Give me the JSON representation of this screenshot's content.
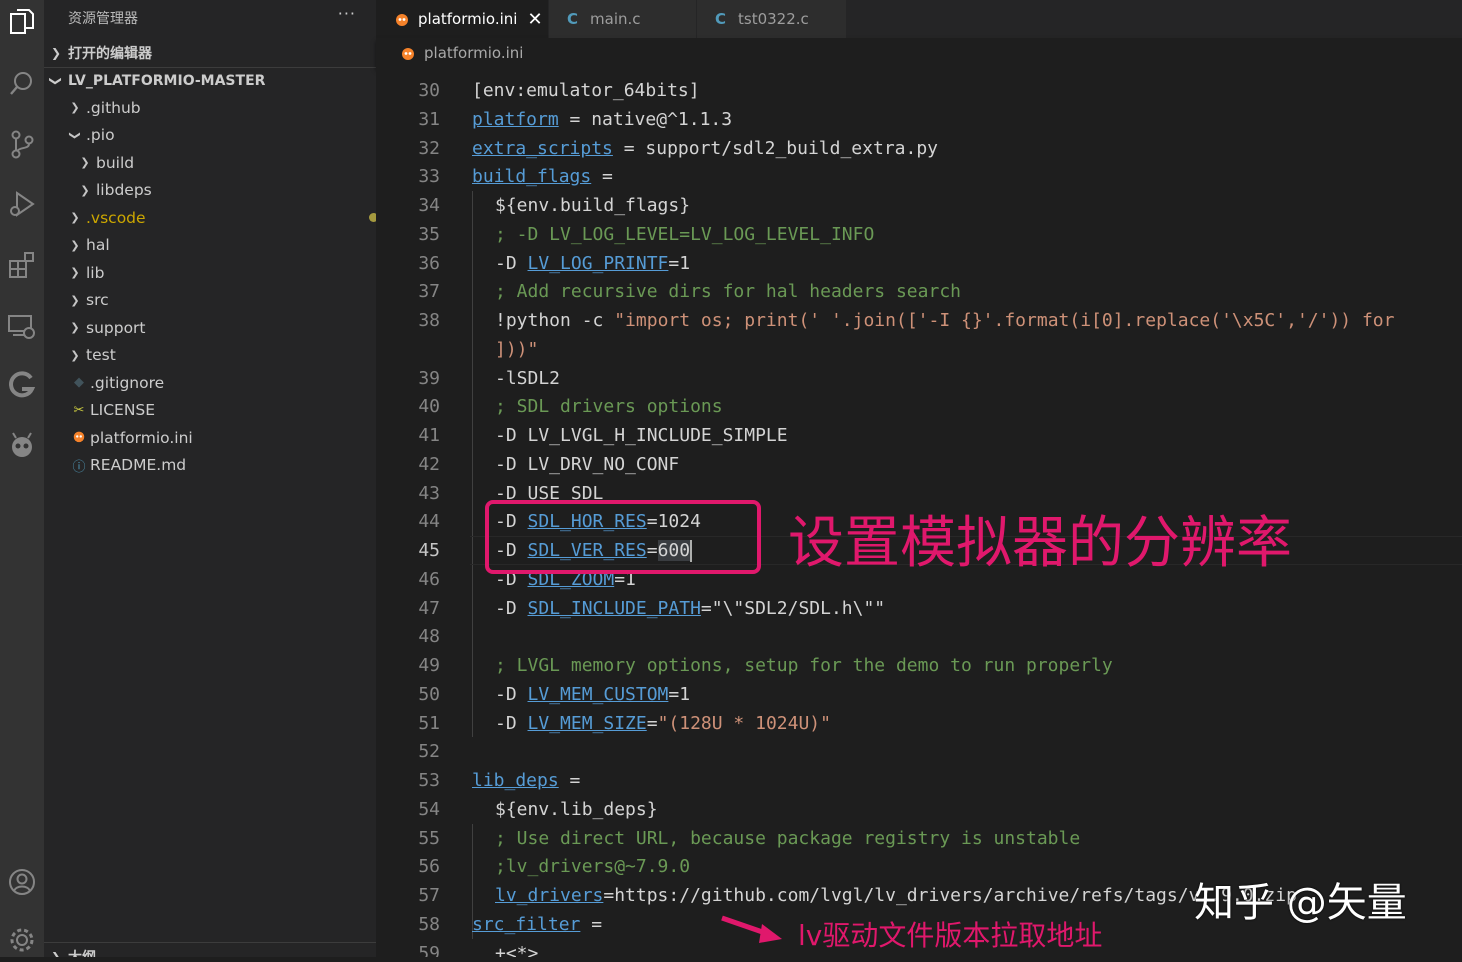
{
  "explorer": {
    "title": "资源管理器",
    "more": "···",
    "open_editors": "打开的编辑器",
    "project": "LV_PLATFORMIO-MASTER",
    "outline": "大纲",
    "tree": [
      {
        "label": ".github",
        "kind": "folder",
        "depth": 1,
        "expanded": false
      },
      {
        "label": ".pio",
        "kind": "folder",
        "depth": 1,
        "expanded": true
      },
      {
        "label": "build",
        "kind": "folder",
        "depth": 2,
        "expanded": false
      },
      {
        "label": "libdeps",
        "kind": "folder",
        "depth": 2,
        "expanded": false
      },
      {
        "label": ".vscode",
        "kind": "folder",
        "depth": 1,
        "expanded": false,
        "modified": true
      },
      {
        "label": "hal",
        "kind": "folder",
        "depth": 1,
        "expanded": false
      },
      {
        "label": "lib",
        "kind": "folder",
        "depth": 1,
        "expanded": false
      },
      {
        "label": "src",
        "kind": "folder",
        "depth": 1,
        "expanded": false
      },
      {
        "label": "support",
        "kind": "folder",
        "depth": 1,
        "expanded": false
      },
      {
        "label": "test",
        "kind": "folder",
        "depth": 1,
        "expanded": false
      },
      {
        "label": ".gitignore",
        "kind": "file",
        "icon": "diamond-icon",
        "depth": 1
      },
      {
        "label": "LICENSE",
        "kind": "file",
        "icon": "license-icon",
        "depth": 1
      },
      {
        "label": "platformio.ini",
        "kind": "file",
        "icon": "platformio-icon",
        "depth": 1
      },
      {
        "label": "README.md",
        "kind": "file",
        "icon": "info-icon",
        "depth": 1
      }
    ]
  },
  "tabs": [
    {
      "label": "platformio.ini",
      "icon": "platformio-icon",
      "active": true,
      "close": "✕"
    },
    {
      "label": "main.c",
      "icon": "c-file-icon",
      "glyph": "C",
      "active": false
    },
    {
      "label": "tst0322.c",
      "icon": "c-file-icon",
      "glyph": "C",
      "active": false
    }
  ],
  "breadcrumb": {
    "file": "platformio.ini"
  },
  "editor": {
    "current_line": 45,
    "lines": [
      {
        "n": "30",
        "indent": 0,
        "parts": [
          {
            "t": "[env:emulator_64bits]",
            "c": "pl"
          }
        ]
      },
      {
        "n": "31",
        "indent": 0,
        "parts": [
          {
            "t": "platform",
            "c": "k"
          },
          {
            "t": " = native@^1.1.3",
            "c": "pl"
          }
        ]
      },
      {
        "n": "32",
        "indent": 0,
        "parts": [
          {
            "t": "extra_scripts",
            "c": "k"
          },
          {
            "t": " = support/sdl2_build_extra.py",
            "c": "pl"
          }
        ]
      },
      {
        "n": "33",
        "indent": 0,
        "parts": [
          {
            "t": "build_flags",
            "c": "k"
          },
          {
            "t": " =",
            "c": "pl"
          }
        ]
      },
      {
        "n": "34",
        "indent": 1,
        "parts": [
          {
            "t": "${env.build_flags}",
            "c": "pl"
          }
        ]
      },
      {
        "n": "35",
        "indent": 1,
        "parts": [
          {
            "t": "; -D LV_LOG_LEVEL=LV_LOG_LEVEL_INFO",
            "c": "cm"
          }
        ]
      },
      {
        "n": "36",
        "indent": 1,
        "parts": [
          {
            "t": "-D ",
            "c": "pl"
          },
          {
            "t": "LV_LOG_PRINTF",
            "c": "k"
          },
          {
            "t": "=1",
            "c": "pl"
          }
        ]
      },
      {
        "n": "37",
        "indent": 1,
        "parts": [
          {
            "t": "; Add recursive dirs for hal headers search",
            "c": "cm"
          }
        ]
      },
      {
        "n": "38",
        "indent": 1,
        "parts": [
          {
            "t": "!python -c ",
            "c": "pl"
          },
          {
            "t": "\"import os; print(' '.join(['-I {}'.format(i[0].replace('\\x5C','/')) for",
            "c": "st"
          }
        ]
      },
      {
        "n": "",
        "indent": 1,
        "parts": [
          {
            "t": "]))\"",
            "c": "st"
          }
        ]
      },
      {
        "n": "39",
        "indent": 1,
        "parts": [
          {
            "t": "-lSDL2",
            "c": "pl"
          }
        ]
      },
      {
        "n": "40",
        "indent": 1,
        "parts": [
          {
            "t": "; SDL drivers options",
            "c": "cm"
          }
        ]
      },
      {
        "n": "41",
        "indent": 1,
        "parts": [
          {
            "t": "-D LV_LVGL_H_INCLUDE_SIMPLE",
            "c": "pl"
          }
        ]
      },
      {
        "n": "42",
        "indent": 1,
        "parts": [
          {
            "t": "-D LV_DRV_NO_CONF",
            "c": "pl"
          }
        ]
      },
      {
        "n": "43",
        "indent": 1,
        "parts": [
          {
            "t": "-D USE_SDL",
            "c": "pl"
          }
        ]
      },
      {
        "n": "44",
        "indent": 1,
        "parts": [
          {
            "t": "-D ",
            "c": "pl"
          },
          {
            "t": "SDL_HOR_RES",
            "c": "k"
          },
          {
            "t": "=1024",
            "c": "pl"
          }
        ]
      },
      {
        "n": "45",
        "indent": 1,
        "parts": [
          {
            "t": "-D ",
            "c": "pl"
          },
          {
            "t": "SDL_VER_RES",
            "c": "k"
          },
          {
            "t": "=",
            "c": "pl"
          },
          {
            "t": "600",
            "c": "pl hl"
          }
        ],
        "cursor": true
      },
      {
        "n": "46",
        "indent": 1,
        "parts": [
          {
            "t": "-D ",
            "c": "pl"
          },
          {
            "t": "SDL_ZOOM",
            "c": "k"
          },
          {
            "t": "=1",
            "c": "pl"
          }
        ]
      },
      {
        "n": "47",
        "indent": 1,
        "parts": [
          {
            "t": "-D ",
            "c": "pl"
          },
          {
            "t": "SDL_INCLUDE_PATH",
            "c": "k"
          },
          {
            "t": "=\"\\\"SDL2/SDL.h\\\"\"",
            "c": "pl"
          }
        ]
      },
      {
        "n": "48",
        "indent": 1,
        "parts": []
      },
      {
        "n": "49",
        "indent": 1,
        "parts": [
          {
            "t": "; LVGL memory options, setup for the demo to run properly",
            "c": "cm"
          }
        ]
      },
      {
        "n": "50",
        "indent": 1,
        "parts": [
          {
            "t": "-D ",
            "c": "pl"
          },
          {
            "t": "LV_MEM_CUSTOM",
            "c": "k"
          },
          {
            "t": "=1",
            "c": "pl"
          }
        ]
      },
      {
        "n": "51",
        "indent": 1,
        "parts": [
          {
            "t": "-D ",
            "c": "pl"
          },
          {
            "t": "LV_MEM_SIZE",
            "c": "k"
          },
          {
            "t": "=",
            "c": "pl"
          },
          {
            "t": "\"(128U * 1024U)\"",
            "c": "st"
          }
        ]
      },
      {
        "n": "52",
        "indent": 1,
        "parts": []
      },
      {
        "n": "53",
        "indent": 0,
        "parts": [
          {
            "t": "lib_deps",
            "c": "k"
          },
          {
            "t": " =",
            "c": "pl"
          }
        ]
      },
      {
        "n": "54",
        "indent": 1,
        "parts": [
          {
            "t": "${env.lib_deps}",
            "c": "pl"
          }
        ]
      },
      {
        "n": "55",
        "indent": 1,
        "parts": [
          {
            "t": "; Use direct URL, because package registry is unstable",
            "c": "cm"
          }
        ]
      },
      {
        "n": "56",
        "indent": 1,
        "parts": [
          {
            "t": ";lv_drivers@~7.9.0",
            "c": "cm"
          }
        ]
      },
      {
        "n": "57",
        "indent": 1,
        "parts": [
          {
            "t": "lv_drivers",
            "c": "k"
          },
          {
            "t": "=https://github.com/lvgl/lv_drivers/archive/refs/tags/v7.9.0.zip",
            "c": "pl"
          }
        ]
      },
      {
        "n": "58",
        "indent": 0,
        "parts": [
          {
            "t": "src_filter",
            "c": "k"
          },
          {
            "t": " =",
            "c": "pl"
          }
        ]
      },
      {
        "n": "59",
        "indent": 1,
        "parts": [
          {
            "t": "+<*>",
            "c": "pl"
          }
        ]
      }
    ]
  },
  "annotations": {
    "resolution": "设置模拟器的分辨率",
    "driver_url": "lv驱动文件版本拉取地址",
    "watermark": "知乎 @矢量"
  },
  "colors": {
    "accent_annotation": "#e0186c",
    "keyword": "#569cd6",
    "comment": "#6a9955",
    "string": "#ce9178"
  }
}
